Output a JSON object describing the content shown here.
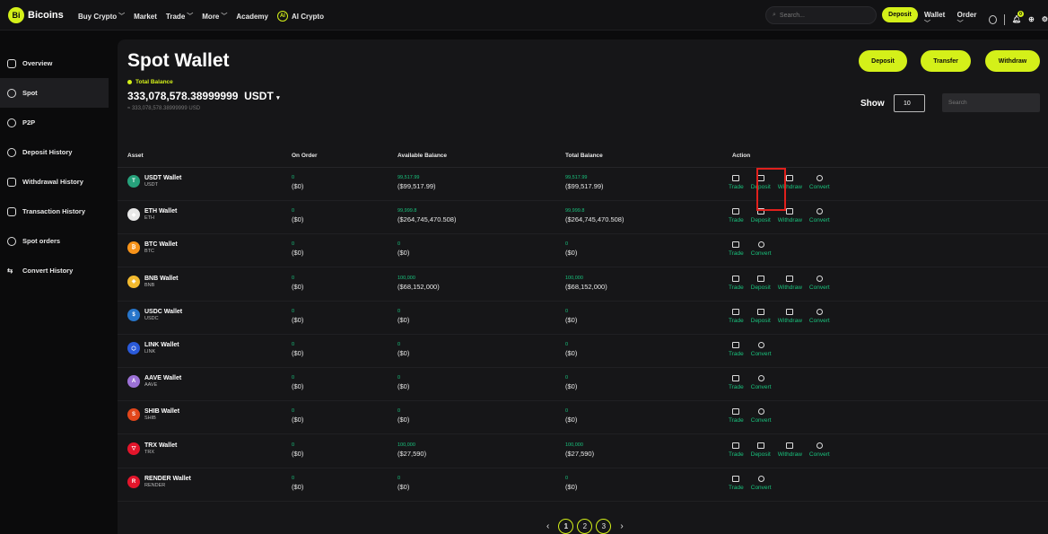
{
  "brand": {
    "mark": "Bi",
    "name": "Bicoins"
  },
  "nav": {
    "buy_crypto": "Buy Crypto",
    "market": "Market",
    "trade": "Trade",
    "more": "More",
    "academy": "Academy",
    "ai_crypto": "AI Crypto",
    "search_placeholder": "Search...",
    "deposit": "Deposit",
    "wallet": "Wallet",
    "order": "Order",
    "notification_count": "0"
  },
  "sidebar": {
    "items": [
      {
        "label": "Overview",
        "icon": "wallet-icon"
      },
      {
        "label": "Spot",
        "icon": "coin-icon"
      },
      {
        "label": "P2P",
        "icon": "p2p-icon"
      },
      {
        "label": "Deposit History",
        "icon": "deposit-history-icon"
      },
      {
        "label": "Withdrawal History",
        "icon": "withdrawal-history-icon"
      },
      {
        "label": "Transaction History",
        "icon": "transaction-history-icon"
      },
      {
        "label": "Spot orders",
        "icon": "orders-icon"
      },
      {
        "label": "Convert History",
        "icon": "convert-icon"
      }
    ],
    "active_index": 1
  },
  "header": {
    "title": "Spot Wallet",
    "total_balance_label": "Total Balance",
    "total_balance_value": "333,078,578.38999999",
    "currency": "USDT",
    "usd_equivalent": "≈ 333,078,578.38999999 USD",
    "deposit_btn": "Deposit",
    "transfer_btn": "Transfer",
    "withdraw_btn": "Withdraw",
    "show_label": "Show",
    "show_value": "10",
    "search_placeholder": "Search"
  },
  "table": {
    "columns": [
      "Asset",
      "On Order",
      "Available Balance",
      "Total Balance",
      "Action"
    ],
    "action_labels": {
      "trade": "Trade",
      "deposit": "Deposit",
      "withdraw": "Withdraw",
      "convert": "Convert"
    },
    "rows": [
      {
        "name": "USDT Wallet",
        "symbol": "USDT",
        "color": "#26a17b",
        "glyph": "T",
        "on_order": "0",
        "on_order_usd": "($0)",
        "available": "99,517.99",
        "available_usd": "($99,517.99)",
        "total": "99,517.99",
        "total_usd": "($99,517.99)",
        "full_actions": true
      },
      {
        "name": "ETH Wallet",
        "symbol": "ETH",
        "color": "#e8e8e8",
        "glyph": "◆",
        "on_order": "0",
        "on_order_usd": "($0)",
        "available": "99,999.8",
        "available_usd": "($264,745,470.508)",
        "total": "99,999.8",
        "total_usd": "($264,745,470.508)",
        "full_actions": true
      },
      {
        "name": "BTC Wallet",
        "symbol": "BTC",
        "color": "#f7931a",
        "glyph": "₿",
        "on_order": "0",
        "on_order_usd": "($0)",
        "available": "0",
        "available_usd": "($0)",
        "total": "0",
        "total_usd": "($0)",
        "full_actions": false
      },
      {
        "name": "BNB Wallet",
        "symbol": "BNB",
        "color": "#f3ba2f",
        "glyph": "◈",
        "on_order": "0",
        "on_order_usd": "($0)",
        "available": "100,000",
        "available_usd": "($68,152,000)",
        "total": "100,000",
        "total_usd": "($68,152,000)",
        "full_actions": true
      },
      {
        "name": "USDC Wallet",
        "symbol": "USDC",
        "color": "#2775ca",
        "glyph": "$",
        "on_order": "0",
        "on_order_usd": "($0)",
        "available": "0",
        "available_usd": "($0)",
        "total": "0",
        "total_usd": "($0)",
        "full_actions": true
      },
      {
        "name": "LINK Wallet",
        "symbol": "LINK",
        "color": "#2a5ada",
        "glyph": "⬡",
        "on_order": "0",
        "on_order_usd": "($0)",
        "available": "0",
        "available_usd": "($0)",
        "total": "0",
        "total_usd": "($0)",
        "full_actions": false
      },
      {
        "name": "AAVE Wallet",
        "symbol": "AAVE",
        "color": "#9c71d6",
        "glyph": "A",
        "on_order": "0",
        "on_order_usd": "($0)",
        "available": "0",
        "available_usd": "($0)",
        "total": "0",
        "total_usd": "($0)",
        "full_actions": false
      },
      {
        "name": "SHIB Wallet",
        "symbol": "SHIB",
        "color": "#e2461b",
        "glyph": "S",
        "on_order": "0",
        "on_order_usd": "($0)",
        "available": "0",
        "available_usd": "($0)",
        "total": "0",
        "total_usd": "($0)",
        "full_actions": false
      },
      {
        "name": "TRX Wallet",
        "symbol": "TRX",
        "color": "#e3152b",
        "glyph": "▽",
        "on_order": "0",
        "on_order_usd": "($0)",
        "available": "100,000",
        "available_usd": "($27,590)",
        "total": "100,000",
        "total_usd": "($27,590)",
        "full_actions": true
      },
      {
        "name": "RENDER Wallet",
        "symbol": "RENDER",
        "color": "#e3152b",
        "glyph": "R",
        "on_order": "0",
        "on_order_usd": "($0)",
        "available": "0",
        "available_usd": "($0)",
        "total": "0",
        "total_usd": "($0)",
        "full_actions": false
      }
    ]
  },
  "pagination": {
    "prev": "‹",
    "next": "›",
    "pages": [
      "1",
      "2",
      "3"
    ],
    "current": "1"
  },
  "colors": {
    "accent": "#d4f019",
    "positive": "#19c37d",
    "highlight": "#e0201c"
  }
}
